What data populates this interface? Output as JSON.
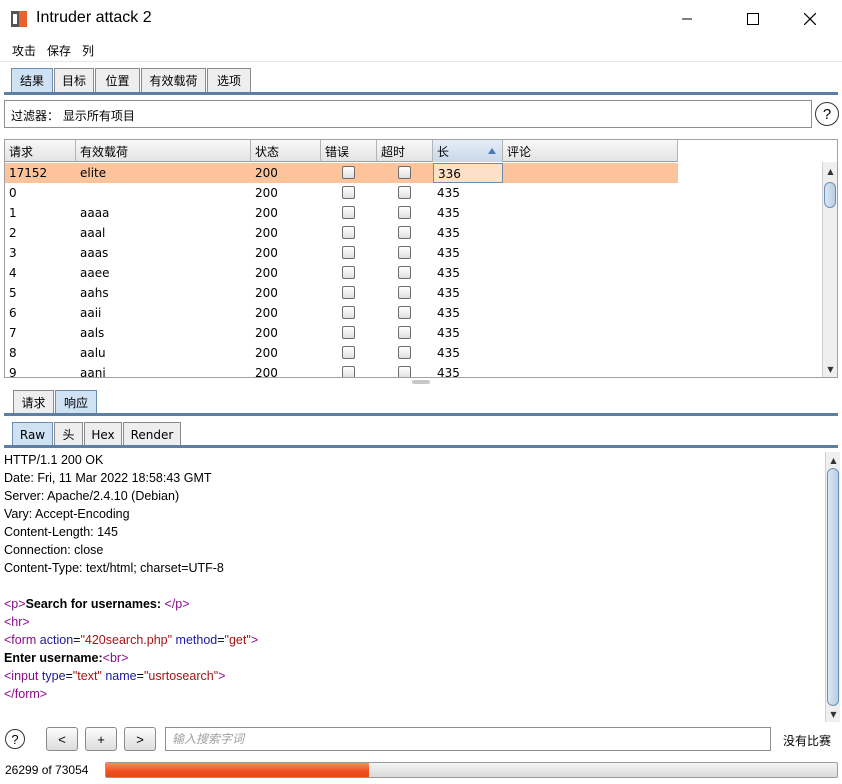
{
  "window": {
    "title": "Intruder attack 2",
    "minimize_icon": "minimize-icon",
    "maximize_icon": "maximize-icon",
    "close_icon": "close-icon"
  },
  "menu": [
    "攻击",
    "保存",
    "列"
  ],
  "main_tabs": [
    {
      "label": "结果",
      "selected": true
    },
    {
      "label": "目标",
      "selected": false
    },
    {
      "label": "位置",
      "selected": false
    },
    {
      "label": "有效载荷",
      "selected": false
    },
    {
      "label": "选项",
      "selected": false
    }
  ],
  "filter": {
    "text": "过滤器： 显示所有项目",
    "help": "?"
  },
  "table": {
    "columns": [
      "请求",
      "有效载荷",
      "状态",
      "错误",
      "超时",
      "长",
      "评论"
    ],
    "sorted_column": "长",
    "rows": [
      {
        "request": "17152",
        "payload": "elite",
        "status": "200",
        "error": false,
        "timeout": false,
        "length": "336",
        "comment": "",
        "selected": true
      },
      {
        "request": "0",
        "payload": "",
        "status": "200",
        "error": false,
        "timeout": false,
        "length": "435",
        "comment": ""
      },
      {
        "request": "1",
        "payload": "aaaa",
        "status": "200",
        "error": false,
        "timeout": false,
        "length": "435",
        "comment": ""
      },
      {
        "request": "2",
        "payload": "aaal",
        "status": "200",
        "error": false,
        "timeout": false,
        "length": "435",
        "comment": ""
      },
      {
        "request": "3",
        "payload": "aaas",
        "status": "200",
        "error": false,
        "timeout": false,
        "length": "435",
        "comment": ""
      },
      {
        "request": "4",
        "payload": "aaee",
        "status": "200",
        "error": false,
        "timeout": false,
        "length": "435",
        "comment": ""
      },
      {
        "request": "5",
        "payload": "aahs",
        "status": "200",
        "error": false,
        "timeout": false,
        "length": "435",
        "comment": ""
      },
      {
        "request": "6",
        "payload": "aaii",
        "status": "200",
        "error": false,
        "timeout": false,
        "length": "435",
        "comment": ""
      },
      {
        "request": "7",
        "payload": "aals",
        "status": "200",
        "error": false,
        "timeout": false,
        "length": "435",
        "comment": ""
      },
      {
        "request": "8",
        "payload": "aalu",
        "status": "200",
        "error": false,
        "timeout": false,
        "length": "435",
        "comment": ""
      },
      {
        "request": "9",
        "payload": "aani",
        "status": "200",
        "error": false,
        "timeout": false,
        "length": "435",
        "comment": ""
      }
    ]
  },
  "detail_tabs": [
    {
      "label": "请求",
      "selected": false
    },
    {
      "label": "响应",
      "selected": true
    }
  ],
  "view_tabs": [
    {
      "label": "Raw",
      "selected": true
    },
    {
      "label": "头",
      "selected": false
    },
    {
      "label": "Hex",
      "selected": false
    },
    {
      "label": "Render",
      "selected": false
    }
  ],
  "response": {
    "headers": [
      "HTTP/1.1 200 OK",
      "Date: Fri, 11 Mar 2022 18:58:43 GMT",
      "Server: Apache/2.4.10 (Debian)",
      "Vary: Accept-Encoding",
      "Content-Length: 145",
      "Connection: close",
      "Content-Type: text/html; charset=UTF-8"
    ],
    "body": {
      "p_open": "<p>",
      "p_text": "Search for usernames: ",
      "p_close": "</p>",
      "hr": "<hr>",
      "form_open": "<form",
      "form_attr1": "action",
      "form_val1": "\"420search.php\"",
      "form_attr2": "method",
      "form_val2": "\"get\"",
      "form_end": ">",
      "enter_text": "Enter username:",
      "br": "<br>",
      "input_open": "<input",
      "input_attr1": "type",
      "input_val1": "\"text\"",
      "input_attr2": "name",
      "input_val2": "\"usrtosearch\"",
      "input_end": ">",
      "form_close": "</form>"
    }
  },
  "bottom": {
    "help": "?",
    "prev": "<",
    "add": "+",
    "next": ">",
    "search_placeholder": "输入搜索字词",
    "matches": "没有比赛"
  },
  "status": {
    "progress_text": "26299 of 73054",
    "progress_fraction": 0.36,
    "progress_color": "#f0501e"
  }
}
